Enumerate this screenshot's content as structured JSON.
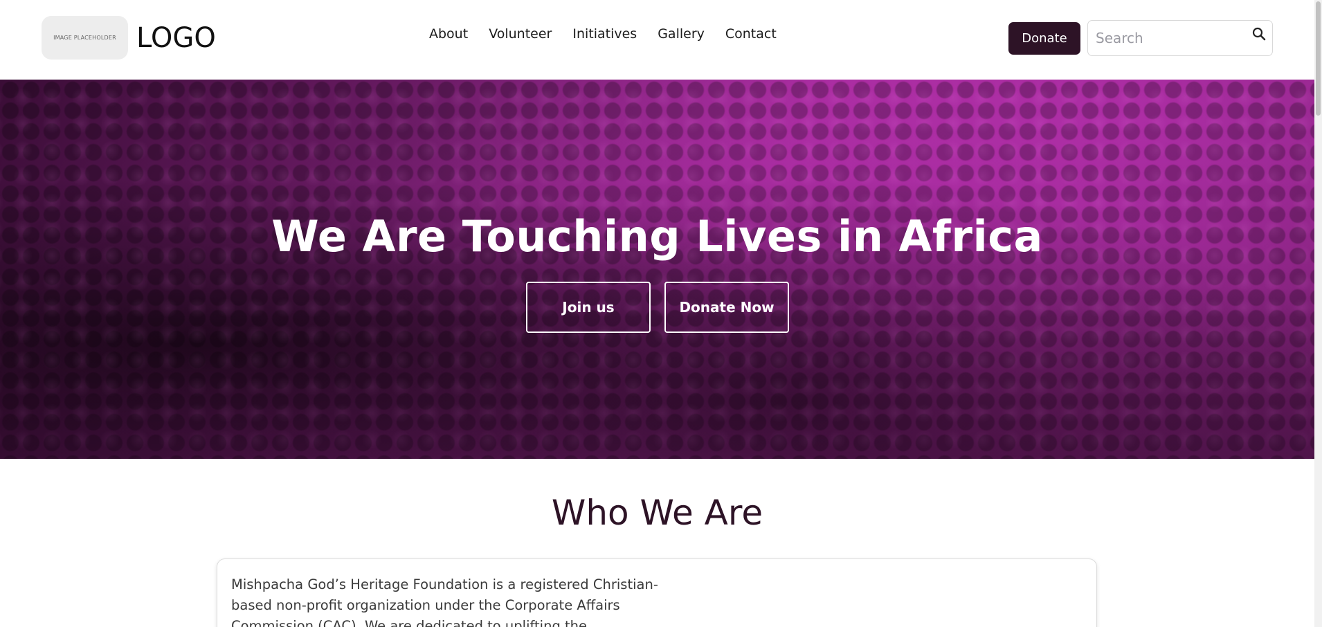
{
  "header": {
    "logo_placeholder": "IMAGE PLACEHOLDER",
    "logo_text": "LOGO",
    "nav": [
      "About",
      "Volunteer",
      "Initiatives",
      "Gallery",
      "Contact"
    ],
    "donate_label": "Donate",
    "search_placeholder": "Search"
  },
  "hero": {
    "title": "We Are Touching Lives in Africa",
    "join_label": "Join us",
    "donate_now_label": "Donate Now"
  },
  "about": {
    "title": "Who We Are",
    "text": "Mishpacha God’s Heritage Foundation is a registered Christian-based non-profit organization under the Corporate Affairs Commission (CAC). We are dedicated to uplifting the"
  },
  "colors": {
    "primary_dark": "#2d1326",
    "hero_magenta": "#a42c9b"
  }
}
